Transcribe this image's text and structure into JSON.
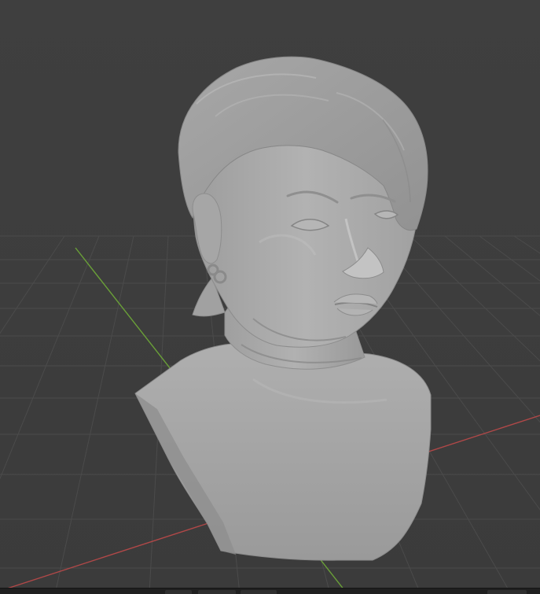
{
  "viewport": {
    "background_color": "#3d3d3d",
    "grid_color": "#4a4a4a",
    "x_axis_color": "#b04848",
    "y_axis_color": "#6aa038",
    "mesh_color": "#a9a9a9"
  },
  "scene": {
    "object": "sculpted-head-bust",
    "features": [
      "hair",
      "face",
      "ear",
      "ear-rings",
      "neck",
      "shoulders"
    ]
  },
  "statusbar": {
    "tabs": [
      "",
      "",
      "",
      ""
    ]
  }
}
